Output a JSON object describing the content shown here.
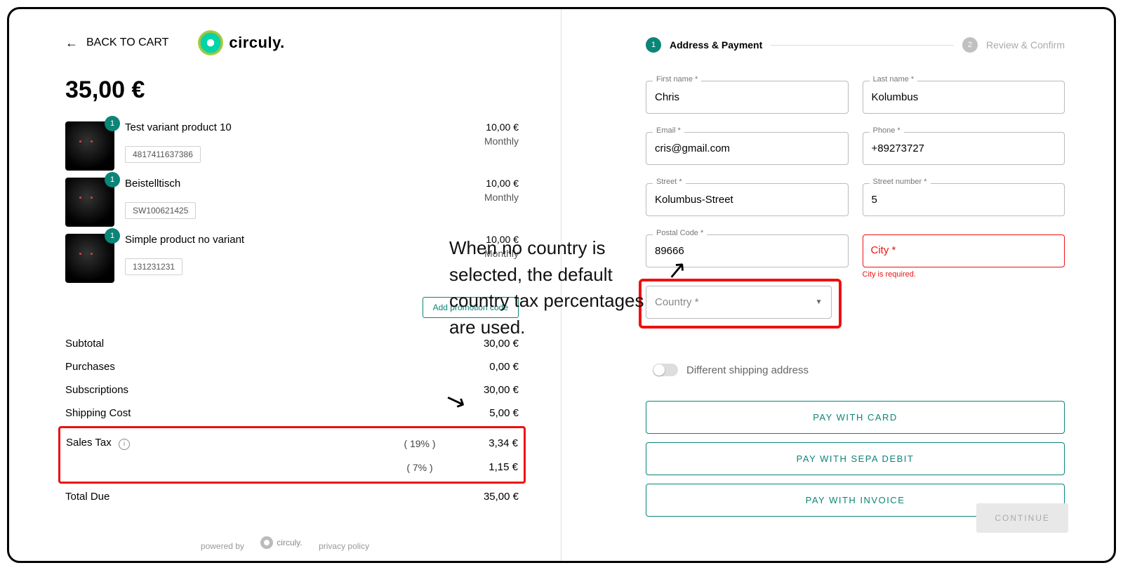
{
  "header": {
    "back_label": "BACK TO CART",
    "brand": "circuly."
  },
  "total": "35,00 €",
  "items": [
    {
      "name": "Test variant product 10",
      "sku": "4817411637386",
      "price": "10,00 €",
      "interval": "Monthly",
      "qty": "1"
    },
    {
      "name": "Beistelltisch",
      "sku": "SW100621425",
      "price": "10,00 €",
      "interval": "Monthly",
      "qty": "1"
    },
    {
      "name": "Simple product no variant",
      "sku": "131231231",
      "price": "10,00 €",
      "interval": "Monthly",
      "qty": "1"
    }
  ],
  "promo_label": "Add promotion code",
  "summary": {
    "subtotal_label": "Subtotal",
    "subtotal_val": "30,00 €",
    "purchases_label": "Purchases",
    "purchases_val": "0,00 €",
    "subs_label": "Subscriptions",
    "subs_val": "30,00 €",
    "ship_label": "Shipping Cost",
    "ship_val": "5,00 €",
    "tax_label": "Sales Tax",
    "tax1_pct": "( 19% )",
    "tax1_val": "3,34 €",
    "tax2_pct": "( 7%  )",
    "tax2_val": "1,15 €",
    "due_label": "Total Due",
    "due_val": "35,00 €"
  },
  "footer": {
    "powered_by": "powered by",
    "brand": "circuly.",
    "privacy": "privacy policy"
  },
  "steps": {
    "s1_num": "1",
    "s1_label": "Address & Payment",
    "s2_num": "2",
    "s2_label": "Review & Confirm"
  },
  "form": {
    "first_name": {
      "label": "First name *",
      "value": "Chris"
    },
    "last_name": {
      "label": "Last name *",
      "value": "Kolumbus"
    },
    "email": {
      "label": "Email *",
      "value": "cris@gmail.com"
    },
    "phone": {
      "label": "Phone *",
      "value": "+89273727"
    },
    "street": {
      "label": "Street *",
      "value": "Kolumbus-Street"
    },
    "street_no": {
      "label": "Street number *",
      "value": "5"
    },
    "postal": {
      "label": "Postal Code *",
      "value": "89666"
    },
    "city": {
      "label": "City *",
      "value": "",
      "error": "City is required."
    },
    "country": {
      "label": "Country *",
      "value": ""
    },
    "diff_ship": "Different shipping address"
  },
  "pay": {
    "card": "PAY WITH CARD",
    "sepa": "PAY WITH SEPA DEBIT",
    "invoice": "PAY WITH INVOICE"
  },
  "continue": "CONTINUE",
  "annotation": "When no country is selected, the default country tax percentages are used."
}
